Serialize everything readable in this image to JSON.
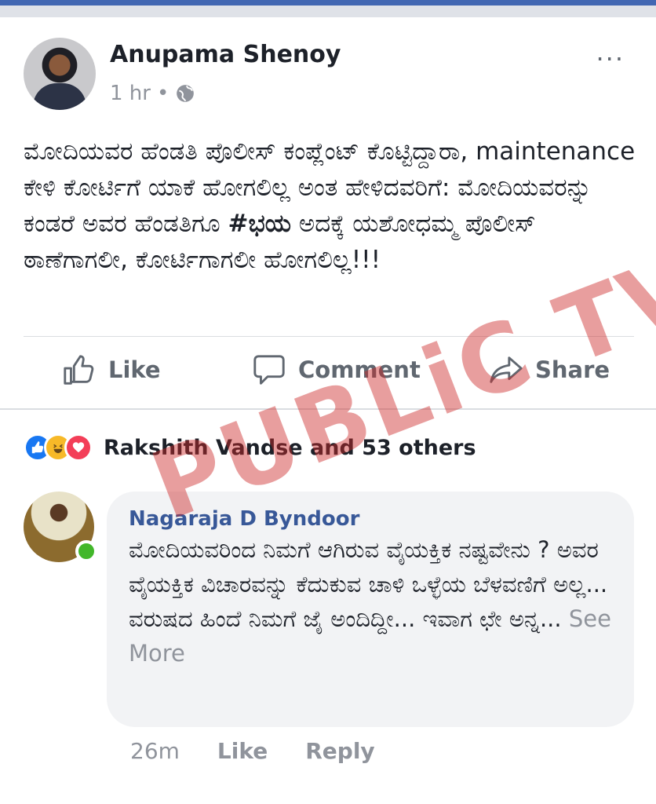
{
  "post": {
    "author": "Anupama Shenoy",
    "time": "1 hr",
    "separator": "•",
    "more_label": "···",
    "text_before": "ಮೋದಿಯವರ ಹೆಂಡತಿ ಪೊಲೀಸ್ ಕಂಪ್ಲೆಂಟ್ ಕೊಟ್ಟಿದ್ದಾರಾ, maintenance ಕೇಳಿ ಕೋರ್ಟಿಗೆ ಯಾಕೆ ಹೋಗಲಿಲ್ಲ ಅಂತ ಹೇಳಿದವರಿಗೆ: ಮೋದಿಯವರನ್ನು ಕಂಡರೆ ಅವರ ಹೆಂಡತಿಗೂ ",
    "hashtag": "#ಭಯ",
    "text_after": " ಅದಕ್ಕೆ ಯಶೋಧಮ್ಮ ಪೊಲೀಸ್ ಠಾಣೆಗಾಗಲೀ, ಕೋರ್ಟಿಗಾಗಲೀ ಹೋಗಲಿಲ್ಲ!!!"
  },
  "actions": {
    "like": "Like",
    "comment": "Comment",
    "share": "Share"
  },
  "reactions": {
    "summary": "Rakshith Vandse and 53 others",
    "icons": [
      "like-icon",
      "haha-icon",
      "love-icon"
    ]
  },
  "comment": {
    "author": "Nagaraja D Byndoor",
    "text": "ಮೋದಿಯವರಿಂದ ನಿಮಗೆ ಆಗಿರುವ ವೈಯಕ್ತಿಕ ನಷ್ಟವೇನು ? ಅವರ ವೈಯಕ್ತಿಕ ವಿಚಾರವನ್ನು ಕೆದುಕುವ ಚಾಳಿ ಒಳ್ಳೆಯ ಬೆಳವಣಿಗೆ ಅಲ್ಲ... ವರುಷದ ಹಿಂದೆ ನಿಮಗೆ ಜೈ ಅಂದಿದ್ದೀ... ಇವಾಗ ಛೇ ಅನ್ನ...",
    "see_more": "See More",
    "time": "26m",
    "like": "Like",
    "reply": "Reply"
  },
  "watermark": "PUBLiC TV",
  "colors": {
    "brand_blue": "#4267b2",
    "link_blue": "#385898",
    "muted": "#90949c",
    "watermark_red": "#cd2828",
    "online_green": "#42b72a"
  }
}
